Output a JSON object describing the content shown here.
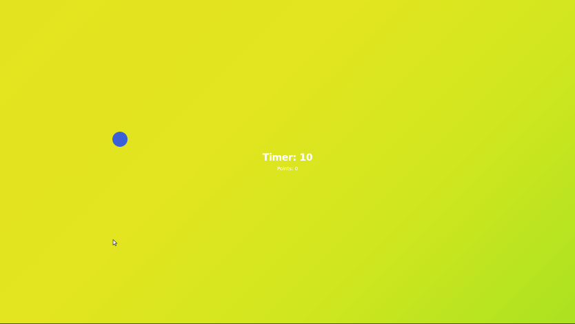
{
  "game": {
    "timer_label": "Timer: 10",
    "score_label": "Points: 0"
  },
  "colors": {
    "background_start": "#e4e31f",
    "background_end": "#abe220",
    "target": "#3a5fd6",
    "text": "#ffffff"
  },
  "icons": {
    "target": "circle-target",
    "cursor": "arrow-cursor"
  }
}
